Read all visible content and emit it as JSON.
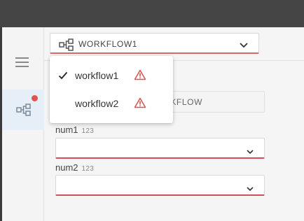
{
  "colors": {
    "topbar": "#454545",
    "accent_error": "#d05050",
    "badge": "#e15252",
    "active_nav": "#e6eef7"
  },
  "icons": {
    "hamburger": "menu-icon",
    "workflow": "workflow-icon",
    "chevron": "chevron-down-icon",
    "check": "check-icon",
    "warning": "warning-icon"
  },
  "workflow_selector": {
    "selected": "WORKFLOW1"
  },
  "menu": {
    "items": [
      {
        "label": "workflow1",
        "selected": true,
        "warning": true
      },
      {
        "label": "workflow2",
        "selected": false,
        "warning": true
      }
    ]
  },
  "form": {
    "name_field_visible": "KFLOW",
    "fields": [
      {
        "label": "num1",
        "type": "123",
        "value": ""
      },
      {
        "label": "num2",
        "type": "123",
        "value": ""
      }
    ]
  }
}
